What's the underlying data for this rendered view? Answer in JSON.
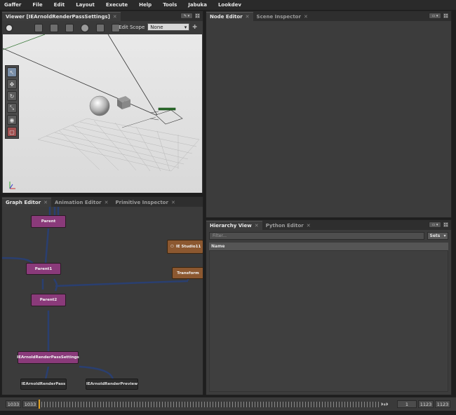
{
  "menu": [
    "Gaffer",
    "File",
    "Edit",
    "Layout",
    "Execute",
    "Help",
    "Tools",
    "Jabuka",
    "Lookdev"
  ],
  "viewer": {
    "tab": "Viewer [IEArnoldRenderPassSettings]",
    "edit_scope_label": "Edit Scope",
    "edit_scope_value": "None"
  },
  "node_editor": {
    "tabs": [
      "Node Editor",
      "Scene Inspector"
    ]
  },
  "hierarchy": {
    "tabs": [
      "Hierarchy View",
      "Python Editor"
    ],
    "filter_placeholder": "Filter...",
    "sets_label": "Sets",
    "column_name": "Name"
  },
  "graph_editor": {
    "tabs": [
      "Graph Editor",
      "Animation Editor",
      "Primitive Inspector"
    ],
    "nodes": {
      "parent": "Parent",
      "parent1": "Parent1",
      "parent2": "Parent2",
      "settings": "IEArnoldRenderPassSettings",
      "renderpass": "IEArnoldRenderPass",
      "renderpreview": "IEArnoldRenderPreview",
      "studio": "IE Studio11",
      "transform": "Transform"
    }
  },
  "timeline": {
    "start_outer": "1033",
    "start_inner": "1033",
    "current": "1",
    "end_inner": "1123",
    "end_outer": "1123"
  },
  "colors": {
    "accent_node_purple": "#8a3a7a",
    "accent_node_orange": "#8c5830",
    "playhead": "#e0a020"
  }
}
